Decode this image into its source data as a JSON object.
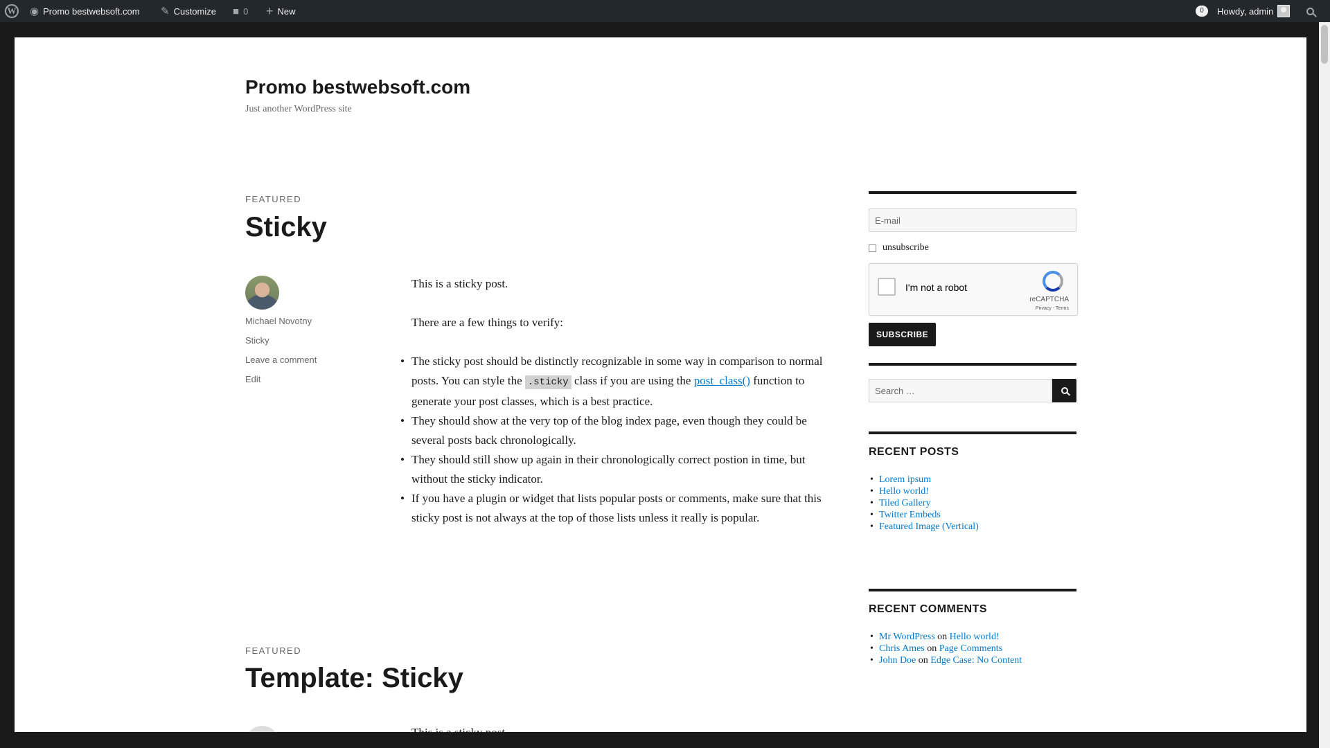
{
  "adminbar": {
    "site_name": "Promo bestwebsoft.com",
    "customize": "Customize",
    "comments_count": "0",
    "new": "New",
    "updates_count": "0",
    "howdy": "Howdy, admin"
  },
  "site": {
    "title": "Promo bestwebsoft.com",
    "description": "Just another WordPress site"
  },
  "posts": [
    {
      "label": "FEATURED",
      "title": "Sticky",
      "author": "Michael Novotny",
      "category": "Sticky",
      "comment_link": "Leave a comment",
      "edit_link": "Edit",
      "content": {
        "p1": "This is a sticky post.",
        "p2": "There are a few things to verify:",
        "b1_a": "The sticky post should be distinctly recognizable in some way in comparison to normal posts. You can style the ",
        "b1_code": ".sticky",
        "b1_b": " class if you are using the ",
        "b1_link": "post_class()",
        "b1_c": " function to generate your post classes, which is a best practice.",
        "b2": "They should show at the very top of the blog index page, even though they could be several posts back chronologically.",
        "b3": "They should still show up again in their chronologically correct postion in time, but without the sticky indicator.",
        "b4": "If you have a plugin or widget that lists popular posts or comments, make sure that this sticky post is not always at the top of those lists unless it really is popular."
      }
    },
    {
      "label": "FEATURED",
      "title": "Template: Sticky",
      "excerpt": "This is a sticky post."
    }
  ],
  "sidebar": {
    "email_placeholder": "E-mail",
    "unsubscribe_label": "unsubscribe",
    "recaptcha_label": "I'm not a robot",
    "recaptcha_brand": "reCAPTCHA",
    "recaptcha_terms": "Privacy - Terms",
    "subscribe_label": "SUBSCRIBE",
    "search_placeholder": "Search …",
    "recent_posts_title": "RECENT POSTS",
    "recent_posts": [
      "Lorem ipsum",
      "Hello world!",
      "Tiled Gallery",
      "Twitter Embeds",
      "Featured Image (Vertical)"
    ],
    "recent_comments_title": "RECENT COMMENTS",
    "recent_comments": [
      {
        "author": "Mr WordPress",
        "on": "on",
        "post": "Hello world!"
      },
      {
        "author": "Chris Ames",
        "on": "on",
        "post": "Page Comments"
      },
      {
        "author": "John Doe",
        "on": "on",
        "post": "Edge Case: No Content"
      }
    ]
  }
}
